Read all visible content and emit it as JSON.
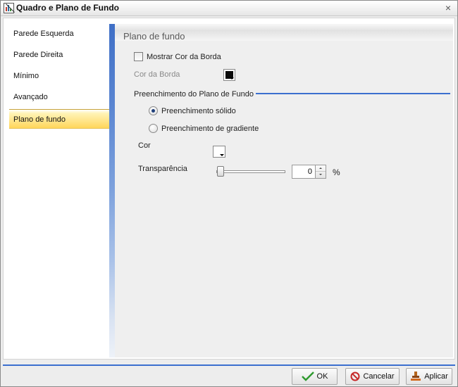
{
  "window": {
    "title": "Quadro e Plano de Fundo",
    "close_glyph": "×"
  },
  "sidebar": {
    "items": [
      {
        "label": "Parede Esquerda"
      },
      {
        "label": "Parede Direita"
      },
      {
        "label": "Mínimo"
      },
      {
        "label": "Avançado"
      },
      {
        "label": "Plano de fundo",
        "selected": true
      }
    ]
  },
  "panel": {
    "title": "Plano de fundo",
    "show_border_color_label": "Mostrar Cor da Borda",
    "show_border_color_checked": false,
    "border_color_label": "Cor da Borda",
    "border_color_value": "#0a0a0a",
    "fill_section_label": "Preenchimento do Plano de Fundo",
    "fill_options": [
      {
        "label": "Preenchimento sólido",
        "selected": true
      },
      {
        "label": "Preenchimento de gradiente",
        "selected": false
      }
    ],
    "color_label": "Cor",
    "color_value": "#ffffff",
    "transparency_label": "Transparência",
    "transparency_value": "0",
    "transparency_fraction": 0,
    "transparency_unit": "%"
  },
  "footer": {
    "ok_label": "OK",
    "cancel_label": "Cancelar",
    "apply_label": "Aplicar"
  },
  "colors": {
    "accent": "#3b6fcf",
    "selected_item": "#ffe58a"
  }
}
